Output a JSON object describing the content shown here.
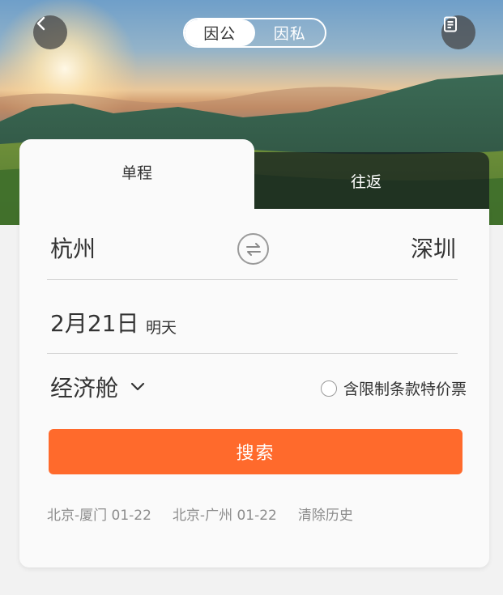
{
  "header": {
    "mode_options": [
      "因公",
      "因私"
    ],
    "mode_selected": "因公"
  },
  "tabs": {
    "one_way": "单程",
    "round_trip": "往返"
  },
  "route": {
    "from": "杭州",
    "to": "深圳"
  },
  "date": {
    "main": "2月21日",
    "sub": "明天"
  },
  "cabin": {
    "label": "经济舱"
  },
  "restriction": {
    "label": "含限制条款特价票",
    "checked": false
  },
  "search": {
    "label": "搜索"
  },
  "history": {
    "items": [
      "北京-厦门 01-22",
      "北京-广州 01-22"
    ],
    "clear_label": "清除历史"
  },
  "colors": {
    "accent": "#ff6a2c",
    "text": "#333333",
    "muted": "#8c8c8c"
  },
  "icons": {
    "back": "chevron-left-icon",
    "menu": "document-list-icon",
    "swap": "swap-arrows-icon",
    "dropdown": "chevron-down-icon"
  }
}
